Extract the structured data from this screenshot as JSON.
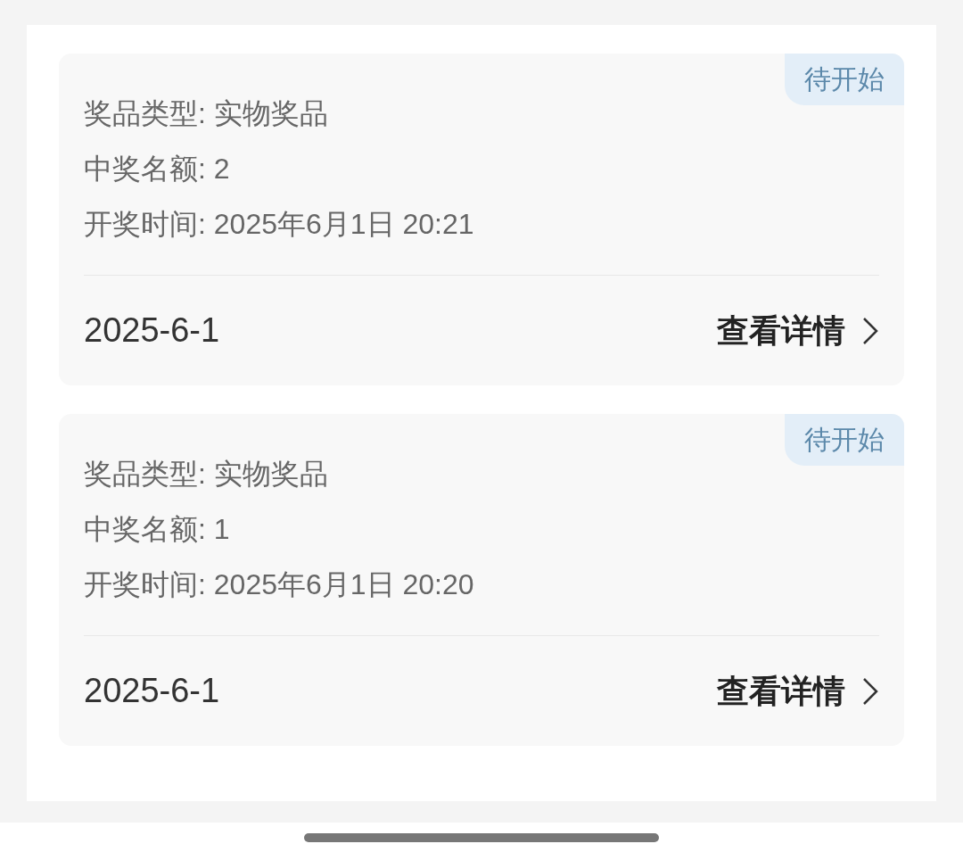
{
  "prizes": [
    {
      "status": "待开始",
      "fields": [
        {
          "label": "奖品类型:",
          "value": "实物奖品"
        },
        {
          "label": "中奖名额:",
          "value": "2"
        },
        {
          "label": "开奖时间:",
          "value": "2025年6月1日 20:21"
        }
      ],
      "date": "2025-6-1",
      "link": "查看详情"
    },
    {
      "status": "待开始",
      "fields": [
        {
          "label": "奖品类型:",
          "value": "实物奖品"
        },
        {
          "label": "中奖名额:",
          "value": "1"
        },
        {
          "label": "开奖时间:",
          "value": "2025年6月1日 20:20"
        }
      ],
      "date": "2025-6-1",
      "link": "查看详情"
    }
  ]
}
